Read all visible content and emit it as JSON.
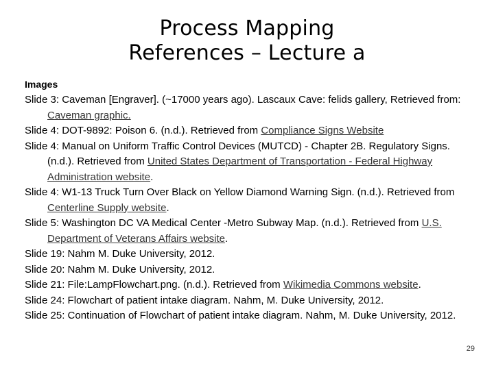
{
  "slide": {
    "title_lines": [
      "Process Mapping",
      "References – Lecture a"
    ],
    "section_heading": "Images",
    "page_number": "29",
    "link_color": "#333333",
    "text_color": "#000000",
    "background_color": "#ffffff"
  },
  "references": [
    {
      "id": "slide-3-caveman",
      "parts": [
        {
          "type": "text",
          "value": "Slide 3: Caveman [Engraver]. (~17000 years ago).  Lascaux Cave:  felids gallery, Retrieved from: "
        },
        {
          "type": "link",
          "value": "Caveman graphic."
        }
      ]
    },
    {
      "id": "slide-4-dot-9892",
      "parts": [
        {
          "type": "text",
          "value": "Slide 4: DOT-9892: Poison 6. (n.d.). Retrieved from "
        },
        {
          "type": "link",
          "value": "Compliance Signs Website"
        }
      ]
    },
    {
      "id": "slide-4-mutcd",
      "parts": [
        {
          "type": "text",
          "value": "Slide 4: Manual on Uniform Traffic Control Devices (MUTCD) - Chapter 2B. Regulatory Signs. (n.d.). Retrieved from "
        },
        {
          "type": "link",
          "value": "United States Department of Transportation - Federal Highway Administration website"
        },
        {
          "type": "text",
          "value": "."
        }
      ]
    },
    {
      "id": "slide-4-w1-13",
      "parts": [
        {
          "type": "text",
          "value": "Slide 4: W1-13 Truck Turn Over Black on Yellow Diamond Warning Sign. (n.d.). Retrieved from "
        },
        {
          "type": "link",
          "value": "Centerline Supply website"
        },
        {
          "type": "text",
          "value": "."
        }
      ]
    },
    {
      "id": "slide-5-dc-va-metro",
      "parts": [
        {
          "type": "text",
          "value": "Slide 5:  Washington DC VA Medical Center -Metro Subway Map. (n.d.). Retrieved from "
        },
        {
          "type": "link",
          "value": "U.S. Department of Veterans Affairs website"
        },
        {
          "type": "text",
          "value": "."
        }
      ]
    },
    {
      "id": "slide-19-nahm",
      "parts": [
        {
          "type": "text",
          "value": "Slide 19:  Nahm M. Duke University, 2012."
        }
      ]
    },
    {
      "id": "slide-20-nahm",
      "parts": [
        {
          "type": "text",
          "value": "Slide 20:  Nahm M. Duke University, 2012."
        }
      ]
    },
    {
      "id": "slide-21-lampflowchart",
      "parts": [
        {
          "type": "text",
          "value": "Slide 21:  File:LampFlowchart.png. (n.d.). Retrieved from "
        },
        {
          "type": "link",
          "value": "Wikimedia Commons website"
        },
        {
          "type": "text",
          "value": "."
        }
      ]
    },
    {
      "id": "slide-24-flowchart",
      "parts": [
        {
          "type": "text",
          "value": "Slide 24: Flowchart of patient intake diagram. Nahm, M. Duke University, 2012."
        }
      ]
    },
    {
      "id": "slide-25-flowchart-continuation",
      "parts": [
        {
          "type": "text",
          "value": "Slide 25: Continuation of Flowchart of patient intake diagram. Nahm, M. Duke University, 2012."
        }
      ]
    }
  ]
}
